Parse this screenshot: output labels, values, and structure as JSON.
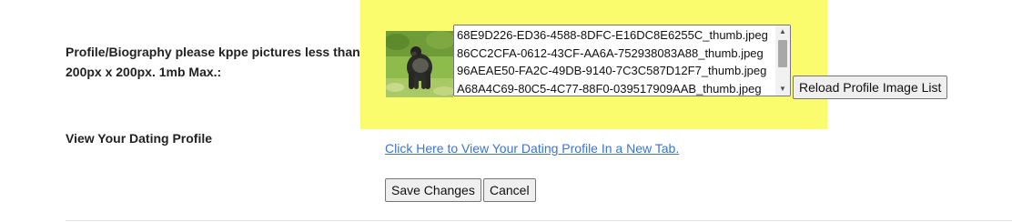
{
  "colors": {
    "highlight": "#fbfb6e",
    "link": "#3b73d6"
  },
  "profile_images": {
    "label": "Profile/Biography please kppe pictures less than 200px x 200px. 1mb Max.:",
    "files": [
      "68E9D226-ED36-4588-8DFC-E16DC8E6255C_thumb.jpeg",
      "86CC2CFA-0612-43CF-AA6A-752938083A88_thumb.jpeg",
      "96AEAE50-FA2C-49DB-9140-7C3C587D12F7_thumb.jpeg",
      "A68A4C69-80C5-4C77-88F0-039517909AAB_thumb.jpeg"
    ],
    "reload_label": "Reload Profile Image List",
    "thumbnail_icon": "gorilla-photo"
  },
  "dating_profile": {
    "label": "View Your Dating Profile",
    "link_text": "Click Here to View Your Dating Profile In a New Tab."
  },
  "actions": {
    "save_label": "Save Changes",
    "cancel_label": "Cancel"
  }
}
